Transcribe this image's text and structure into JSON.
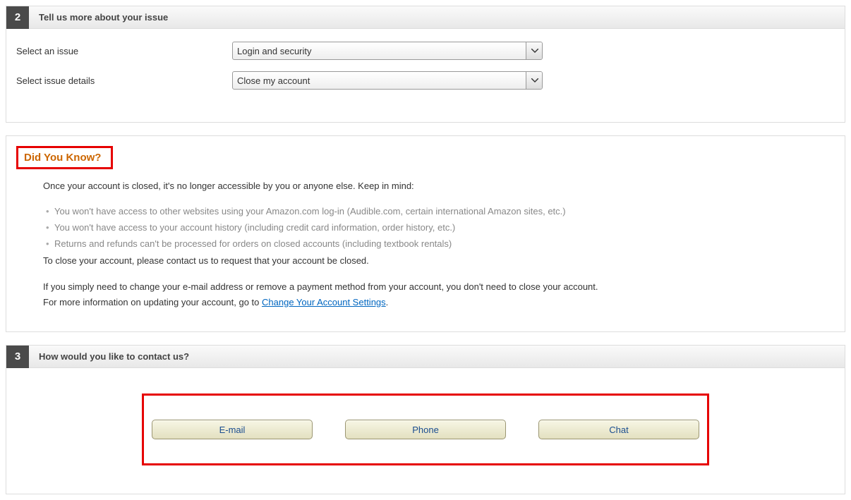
{
  "step2": {
    "number": "2",
    "title": "Tell us more about your issue",
    "issue_label": "Select an issue",
    "issue_value": "Login and security",
    "details_label": "Select issue details",
    "details_value": "Close my account"
  },
  "info": {
    "heading": "Did You Know?",
    "intro": "Once your account is closed, it's no longer accessible by you or anyone else. Keep in mind:",
    "bullets": [
      "You won't have access to other websites using your Amazon.com log-in (Audible.com, certain international Amazon sites, etc.)",
      "You won't have access to your account history (including credit card information, order history, etc.)",
      "Returns and refunds can't be processed for orders on closed accounts (including textbook rentals)"
    ],
    "close_line": "To close your account, please contact us to request that your account be closed.",
    "para1": "If you simply need to change your e-mail address or remove a payment method from your account, you don't need to close your account.",
    "para2_prefix": "For more information on updating your account, go to ",
    "para2_link": "Change Your Account Settings",
    "para2_suffix": "."
  },
  "step3": {
    "number": "3",
    "title": "How would you like to contact us?",
    "buttons": {
      "email": "E-mail",
      "phone": "Phone",
      "chat": "Chat"
    }
  }
}
